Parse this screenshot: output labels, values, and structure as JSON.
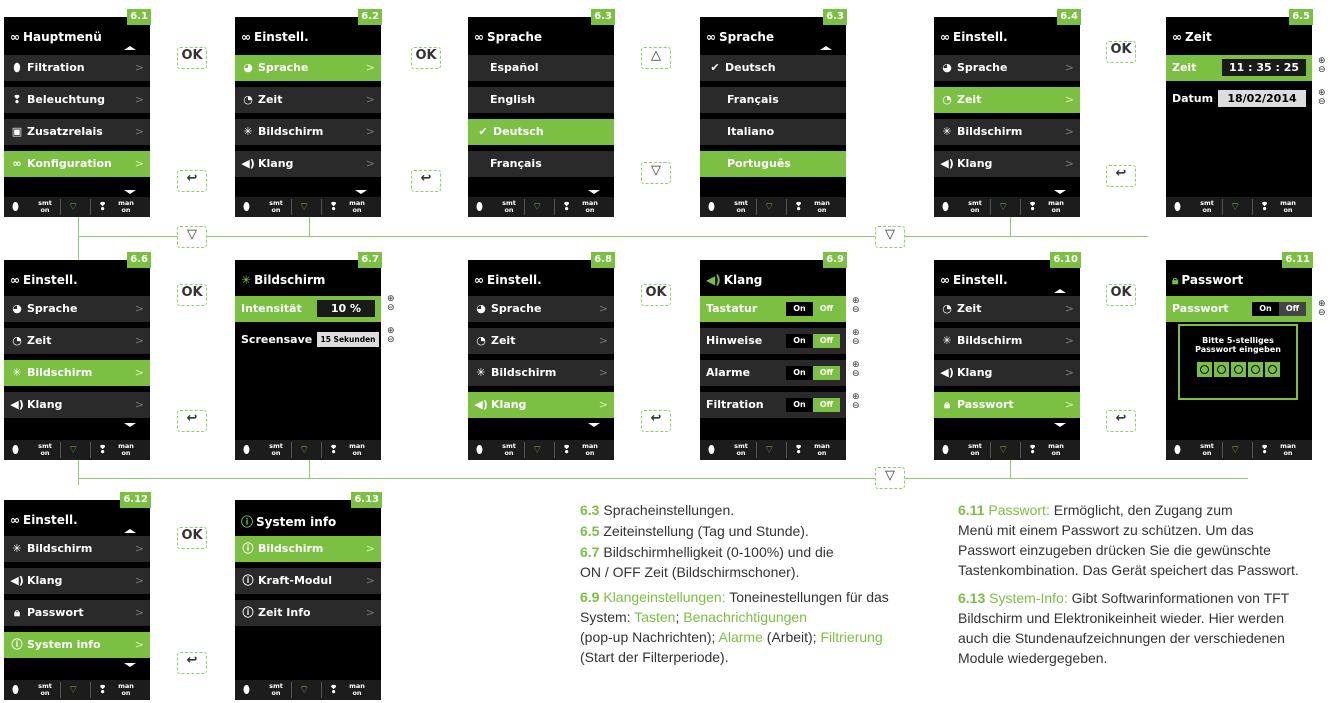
{
  "footer": {
    "smt": "smt",
    "on": "on",
    "man": "man"
  },
  "ok": "OK",
  "screens": {
    "s61": {
      "badge": "6.1",
      "title": "Hauptmenü",
      "rows": [
        "Filtration",
        "Beleuchtung",
        "Zusatzrelais",
        "Konfiguration"
      ]
    },
    "s62": {
      "badge": "6.2",
      "title": "Einstell.",
      "rows": [
        "Sprache",
        "Zeit",
        "Bildschirm",
        "Klang"
      ]
    },
    "s63a": {
      "badge": "6.3",
      "title": "Sprache",
      "rows": [
        "Español",
        "English",
        "Deutsch",
        "Français"
      ]
    },
    "s63b": {
      "badge": "6.3",
      "title": "Sprache",
      "rows": [
        "Deutsch",
        "Français",
        "Italiano",
        "Português"
      ]
    },
    "s64": {
      "badge": "6.4",
      "title": "Einstell.",
      "rows": [
        "Sprache",
        "Zeit",
        "Bildschirm",
        "Klang"
      ]
    },
    "s65": {
      "badge": "6.5",
      "title": "Zeit",
      "zeit_label": "Zeit",
      "zeit_value": "11 : 35 : 25",
      "datum_label": "Datum",
      "datum_value": "18/02/2014"
    },
    "s66": {
      "badge": "6.6",
      "title": "Einstell.",
      "rows": [
        "Sprache",
        "Zeit",
        "Bildschirm",
        "Klang"
      ]
    },
    "s67": {
      "badge": "6.7",
      "title": "Bildschirm",
      "int_label": "Intensität",
      "int_value": "10 %",
      "scr_label": "Screensave",
      "scr_value": "15 Sekunden"
    },
    "s68": {
      "badge": "6.8",
      "title": "Einstell.",
      "rows": [
        "Sprache",
        "Zeit",
        "Bildschirm",
        "Klang"
      ]
    },
    "s69": {
      "badge": "6.9",
      "title": "Klang",
      "rows": [
        "Tastatur",
        "Hinweise",
        "Alarme",
        "Filtration"
      ],
      "on": "On",
      "off": "Off"
    },
    "s610": {
      "badge": "6.10",
      "title": "Einstell.",
      "rows": [
        "Zeit",
        "Bildschirm",
        "Klang",
        "Passwort"
      ]
    },
    "s611": {
      "badge": "6.11",
      "title": "Passwort",
      "label": "Passwort",
      "on": "On",
      "off": "Off",
      "msg1": "Bitte 5-stelliges",
      "msg2": "Passwort eingeben"
    },
    "s612": {
      "badge": "6.12",
      "title": "Einstell.",
      "rows": [
        "Bildschirm",
        "Klang",
        "Passwort",
        "System info"
      ]
    },
    "s613": {
      "badge": "6.13",
      "title": "System info",
      "rows": [
        "Bildschirm",
        "Kraft-Modul",
        "Zeit Info"
      ]
    }
  },
  "descriptions": {
    "d63": {
      "num": "6.3",
      "text": "Spracheinstellungen."
    },
    "d65": {
      "num": "6.5",
      "text": "Zeiteinstellung (Tag und Stunde)."
    },
    "d67": {
      "num": "6.7",
      "line1": "Bildschirmhelligkeit (0-100%) und die",
      "line2": "ON / OFF Zeit (Bildschirmschoner)."
    },
    "d69": {
      "num": "6.9",
      "head": "Klangeinstellungen:",
      "t1": "Toneinestellungen für das",
      "t2": "System:",
      "k1": "Tasten",
      "k2": "Benachrichtigungen",
      "t3": "(pop-up Nachrichten);",
      "k3": "Alarme",
      "t4": "(Arbeit);",
      "k4": "Filtrierung",
      "t5": "(Start der Filterperiode)."
    },
    "d611": {
      "num": "6.11",
      "head": "Passwort:",
      "l1": "Ermöglicht, den Zugang zum",
      "l2": "Menü mit einem Passwort zu schützen. Um das",
      "l3": "Passwort einzugeben drücken Sie die gewünschte",
      "l4": "Tastenkombination. Das Gerät speichert das Passwort."
    },
    "d613": {
      "num": "6.13",
      "head": "System-Info:",
      "l1": "Gibt Softwarinformationen von TFT",
      "l2": "Bildschirm und Elektronikeinheit wieder. Hier werden",
      "l3": "auch die Stundenaufzeichnungen der verschiedenen",
      "l4": "Module wiedergegeben."
    }
  }
}
